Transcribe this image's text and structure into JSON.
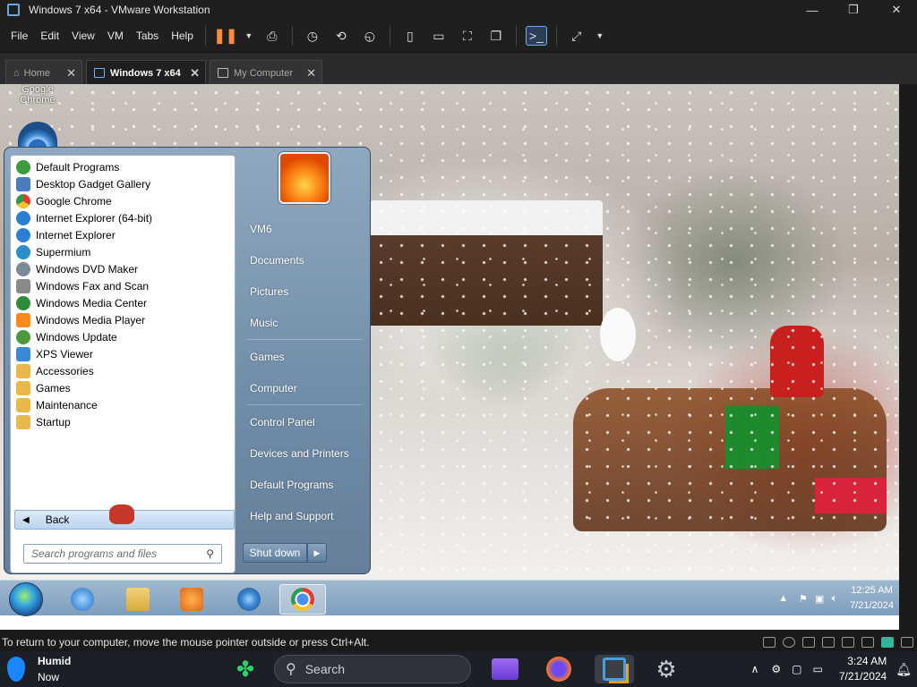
{
  "window": {
    "title": "Windows 7 x64 - VMware Workstation",
    "minimize_glyph": "—",
    "restore_glyph": "❐",
    "close_glyph": "✕"
  },
  "menu": [
    "File",
    "Edit",
    "View",
    "VM",
    "Tabs",
    "Help"
  ],
  "tabs": [
    {
      "label": "Home",
      "active": false
    },
    {
      "label": "Windows 7 x64",
      "active": true
    },
    {
      "label": "My Computer",
      "active": false
    }
  ],
  "desktop": {
    "icon_label": "Google Chrome"
  },
  "start_menu": {
    "programs": [
      {
        "label": "Default Programs",
        "icon": "default-programs-icon",
        "color": "#3a9c3a"
      },
      {
        "label": "Desktop Gadget Gallery",
        "icon": "gadget-gallery-icon",
        "color": "#4a7cc0"
      },
      {
        "label": "Google Chrome",
        "icon": "chrome-icon",
        "color": "#e33b2e"
      },
      {
        "label": "Internet Explorer (64-bit)",
        "icon": "internet-explorer-icon",
        "color": "#2a7fd4"
      },
      {
        "label": "Internet Explorer",
        "icon": "internet-explorer-icon",
        "color": "#2a7fd4"
      },
      {
        "label": "Supermium",
        "icon": "supermium-icon",
        "color": "#2a8fc8"
      },
      {
        "label": "Windows DVD Maker",
        "icon": "dvd-maker-icon",
        "color": "#7a8a9a"
      },
      {
        "label": "Windows Fax and Scan",
        "icon": "fax-scan-icon",
        "color": "#8a8a8a"
      },
      {
        "label": "Windows Media Center",
        "icon": "media-center-icon",
        "color": "#2e8b3a"
      },
      {
        "label": "Windows Media Player",
        "icon": "media-player-icon",
        "color": "#ff8a1a"
      },
      {
        "label": "Windows Update",
        "icon": "windows-update-icon",
        "color": "#4a9a3a"
      },
      {
        "label": "XPS Viewer",
        "icon": "xps-viewer-icon",
        "color": "#3a8ad4"
      },
      {
        "label": "Accessories",
        "icon": "folder-icon",
        "color": "#e8b84a"
      },
      {
        "label": "Games",
        "icon": "folder-icon",
        "color": "#e8b84a"
      },
      {
        "label": "Maintenance",
        "icon": "folder-icon",
        "color": "#e8b84a"
      },
      {
        "label": "Startup",
        "icon": "folder-icon",
        "color": "#e8b84a"
      }
    ],
    "back_label": "Back",
    "search_placeholder": "Search programs and files",
    "right_items": [
      "VM6",
      "Documents",
      "Pictures",
      "Music",
      "Games",
      "Computer",
      "Control Panel",
      "Devices and Printers",
      "Default Programs",
      "Help and Support"
    ],
    "shutdown_label": "Shut down"
  },
  "guest_taskbar": {
    "time": "12:25 AM",
    "date": "7/21/2024"
  },
  "vm_status": {
    "message": "To return to your computer, move the mouse pointer outside or press Ctrl+Alt."
  },
  "host_taskbar": {
    "weather_label": "Humid",
    "weather_sub": "Now",
    "search_placeholder": "Search",
    "time": "3:24 AM",
    "date": "7/21/2024"
  }
}
